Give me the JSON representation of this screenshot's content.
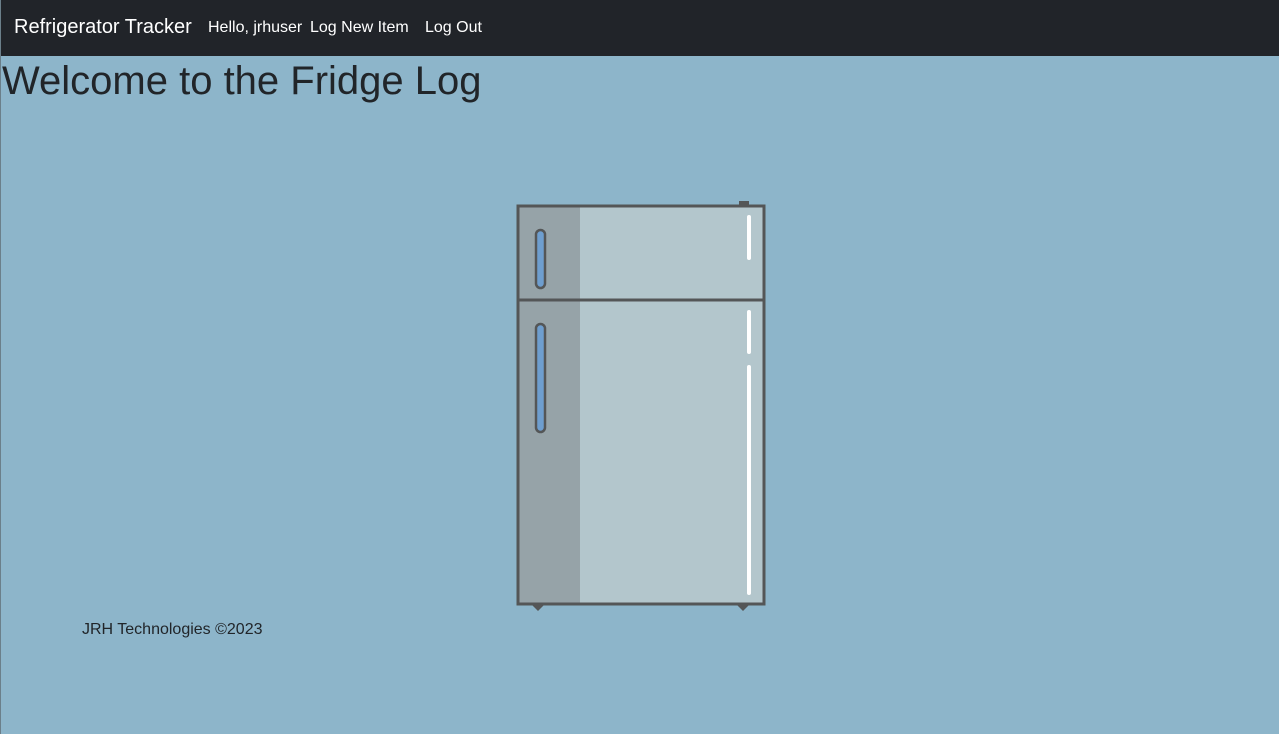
{
  "navbar": {
    "brand": "Refrigerator Tracker",
    "greeting": "Hello, jrhuser",
    "links": [
      "Log New Item",
      "Log Out"
    ]
  },
  "main": {
    "title": "Welcome to the Fridge Log",
    "illustration": {
      "icon": "refrigerator-illustration",
      "colors": {
        "outline": "#545657",
        "door_face": "#b3c6cc",
        "side_shade": "#96a3a8",
        "handle": "#6e9ecf",
        "highlight": "#ffffff"
      }
    }
  },
  "footer": {
    "copyright": "JRH Technologies ©2023"
  },
  "colors": {
    "navbar_bg": "#212429",
    "page_bg": "#8db5ca",
    "text": "#212529"
  }
}
